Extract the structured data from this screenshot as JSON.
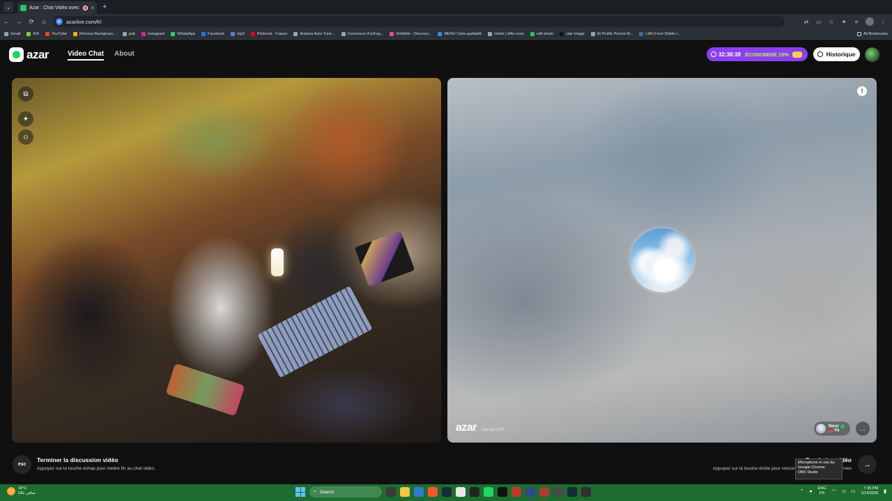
{
  "browser": {
    "tab_title": "Azar : Chat Vidéo avec de",
    "tab_close": "×",
    "new_tab": "+",
    "url": "azarlive.com/fr/",
    "bookmarks": [
      "Gmail",
      "KIK",
      "YouTube",
      "Remove Backgroun...",
      "pub",
      "Instagram",
      "WhatsApp",
      "Facebook",
      "mp3",
      "Pinterest - France",
      "Antares Auto-Tune...",
      "Correcteur d'orthog...",
      "Dribbble - Discover...",
      "MENU Carte garibaldi",
      "mixkit ( effet sono",
      "edit photo",
      "clair image",
      "AI Profile Picture M...",
      "Lilith From Diablo I..."
    ],
    "all_bookmarks": "All Bookmarks"
  },
  "azar": {
    "logo": "azar",
    "nav": {
      "video_chat": "Video Chat",
      "about": "About"
    },
    "timer": "32:38:38",
    "savings": "ÉCONOMISE 15%",
    "history": "Historique"
  },
  "remote": {
    "watermark": "azar",
    "watermark_user": "Salmgha238",
    "peer_name": "Nour",
    "peer_country": "TN",
    "report_glyph": "!"
  },
  "footer": {
    "esc_key": "esc",
    "end_title": "Terminer la discussion vidéo",
    "end_sub": "Appuyez sur la touche échap pour mettre fin au chat vidéo.",
    "next_title": "Prochaine vidéo",
    "next_sub": "Appuyez sur la touche droite pour rencontrer de nouvelles personnes",
    "next_key": "→"
  },
  "tooltip": [
    "Microphone in use by:",
    "Google Chrome",
    "OBS Studio"
  ],
  "taskbar": {
    "temp": "18°C",
    "weather": "صافي غالبًا",
    "search": "Search",
    "lang_1": "ENG",
    "lang_2": "FR",
    "time": "7:35 PM",
    "date": "2/14/2026"
  },
  "colors": {
    "accent_purple": "#8b3ff0",
    "azar_green": "#1ed760",
    "taskbar_green": "#1c6d2f"
  }
}
